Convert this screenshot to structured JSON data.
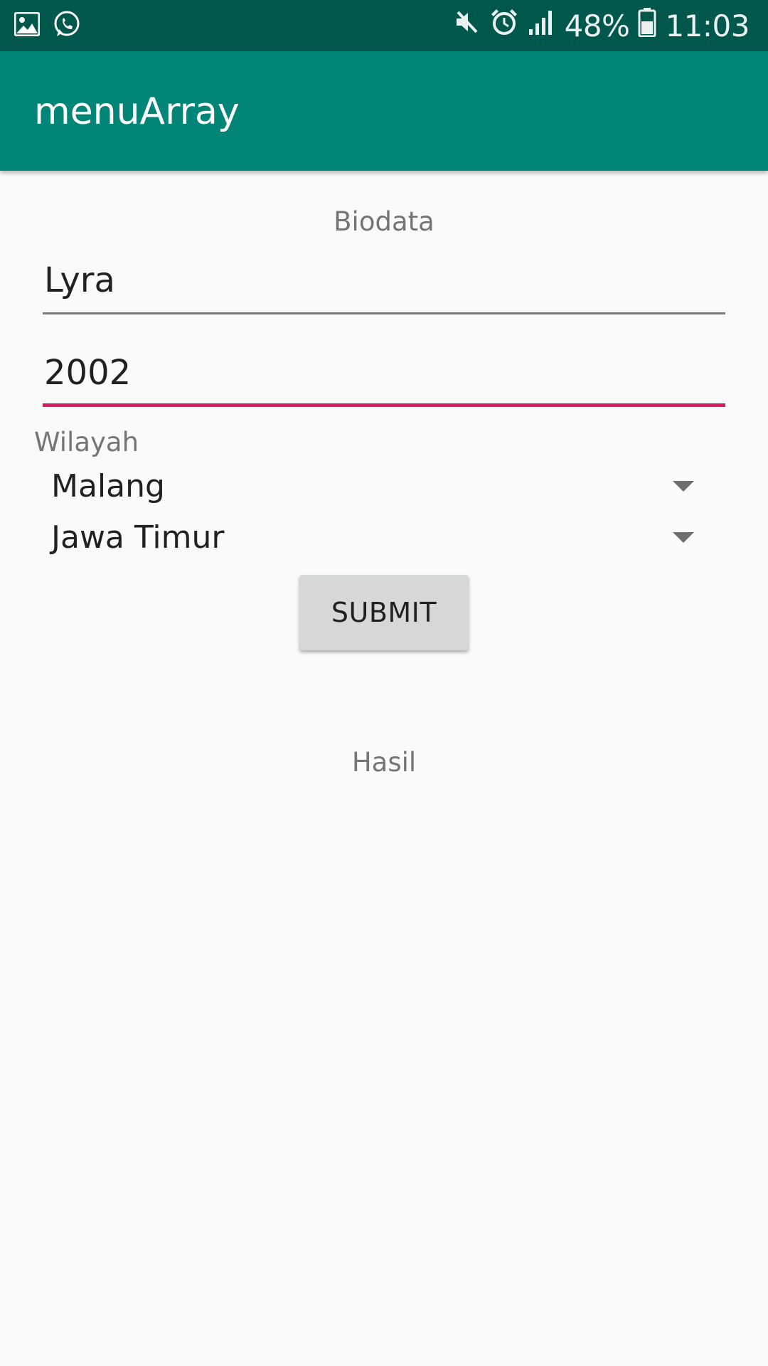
{
  "status_bar": {
    "left_icons": [
      "gallery-icon",
      "whatsapp-icon"
    ],
    "right_icons": [
      "mute-icon",
      "alarm-icon",
      "signal-icon",
      "battery-icon"
    ],
    "battery_text": "48%",
    "time": "11:03"
  },
  "app_bar": {
    "title": "menuArray"
  },
  "form": {
    "heading": "Biodata",
    "name_value": "Lyra",
    "year_value": "2002",
    "region_label": "Wilayah",
    "city_selected": "Malang",
    "province_selected": "Jawa Timur",
    "submit_label": "SUBMIT",
    "result_text": "Hasil"
  },
  "colors": {
    "status_bar": "#00574b",
    "app_bar": "#008577",
    "accent": "#d81b60",
    "background": "#fafafa",
    "button": "#d6d7d7"
  }
}
